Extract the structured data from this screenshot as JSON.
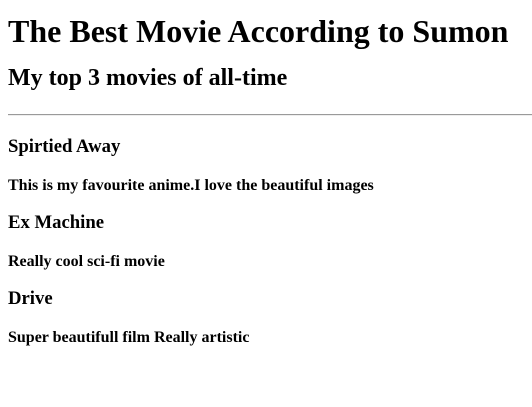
{
  "page": {
    "title": "The Best Movie According to Sumon",
    "subtitle": "My top 3 movies of all-time"
  },
  "movies": [
    {
      "title": "Spirtied Away",
      "description": "This is my favourite anime.I love the beautiful images"
    },
    {
      "title": "Ex Machine",
      "description": "Really cool sci-fi movie"
    },
    {
      "title": "Drive",
      "description": "Super beautifull film Really artistic"
    }
  ]
}
